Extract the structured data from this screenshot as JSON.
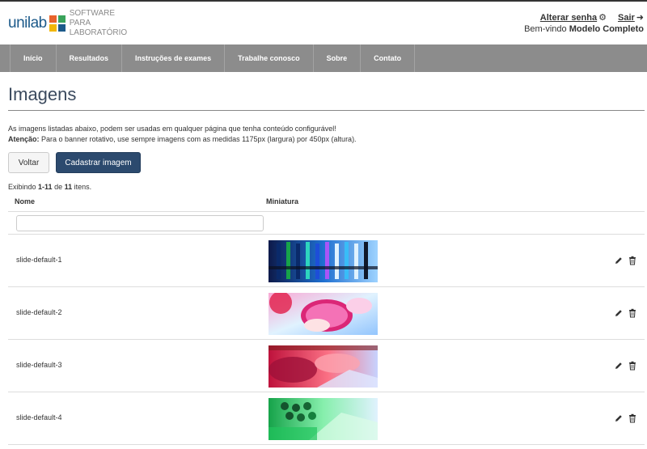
{
  "header": {
    "logo_word": "unilab",
    "logo_tagline": "SOFTWARE PARA LABORATÓRIO",
    "change_password": "Alterar senha",
    "logout": "Sair",
    "welcome_prefix": "Bem-vindo",
    "user_name": "Modelo Completo"
  },
  "nav": {
    "items": [
      "Início",
      "Resultados",
      "Instruções de exames",
      "Trabalhe conosco",
      "Sobre",
      "Contato"
    ]
  },
  "page": {
    "title": "Imagens",
    "description": "As imagens listadas abaixo, podem ser usadas em qualquer página que tenha conteúdo configurável!",
    "warning_label": "Atenção:",
    "warning_text": "Para o banner rotativo, use sempre imagens com as medidas 1175px (largura) por 450px (altura).",
    "back_button": "Voltar",
    "new_button": "Cadastrar imagem"
  },
  "summary": {
    "prefix": "Exibindo",
    "range": "1-11",
    "of": "de",
    "total": "11",
    "suffix": "itens."
  },
  "table": {
    "columns": {
      "name": "Nome",
      "thumbnail": "Miniatura"
    },
    "filter_value": "",
    "rows": [
      {
        "name": "slide-default-1"
      },
      {
        "name": "slide-default-2"
      },
      {
        "name": "slide-default-3"
      },
      {
        "name": "slide-default-4"
      }
    ]
  },
  "icons": {
    "change_password": "gear-icon",
    "logout": "sign-out-icon",
    "edit": "pencil-icon",
    "delete": "trash-icon"
  },
  "colors": {
    "nav_bg": "#8c8c8c",
    "primary_button": "#2c4a6e",
    "title": "#3b4a5e"
  }
}
